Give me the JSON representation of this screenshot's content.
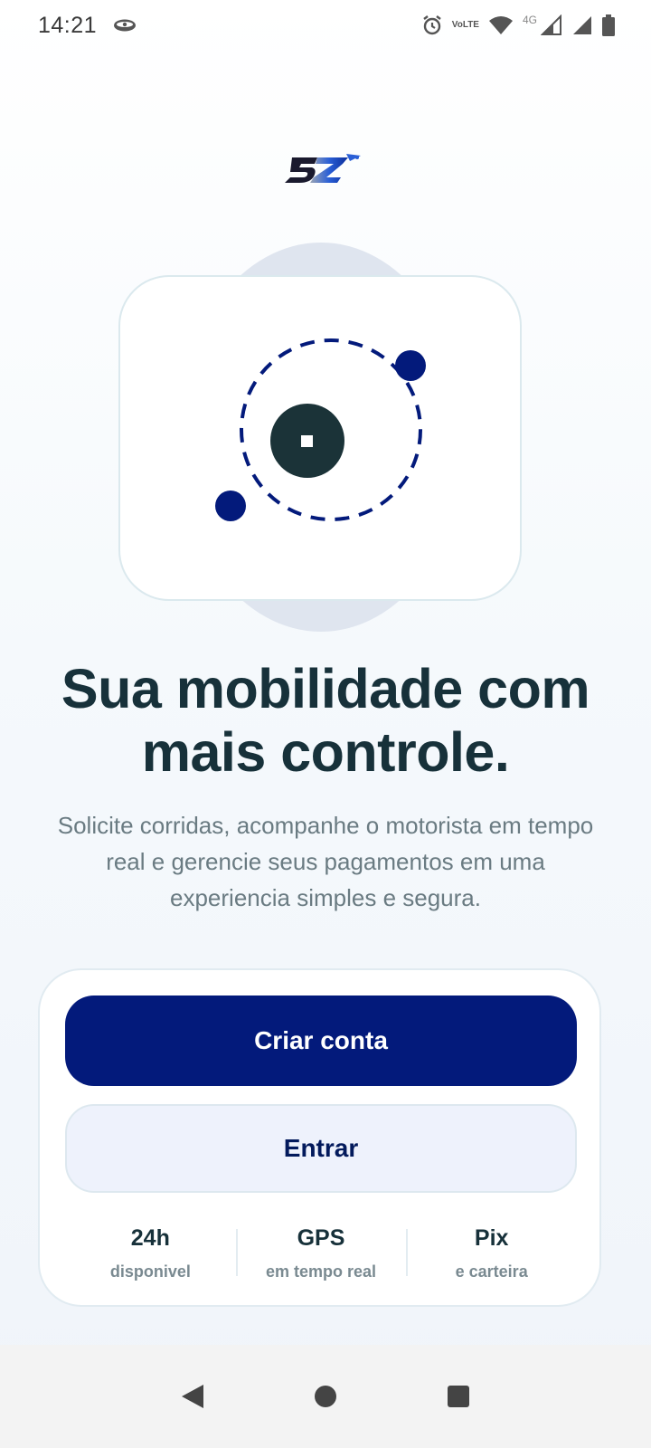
{
  "status_bar": {
    "time": "14:21",
    "volte_top": "Vo",
    "volte_bottom": "LTE",
    "network": "4G",
    "icons": [
      "eye-icon",
      "alarm-icon",
      "volte-icon",
      "wifi-icon",
      "signal-icon",
      "signal-icon",
      "battery-icon"
    ]
  },
  "logo": {
    "text": "5Z",
    "color": "#1e50c8"
  },
  "illustration": {
    "accent": "#031a7b",
    "center_color": "#1b3338",
    "back_color": "#dfe5ef"
  },
  "hero": {
    "title_line1": "Sua mobilidade com",
    "title_line2": "mais controle.",
    "subtitle": "Solicite corridas, acompanhe o motorista em tempo real e gerencie seus pagamentos em uma experiencia simples e segura."
  },
  "actions": {
    "create_account": "Criar conta",
    "login": "Entrar"
  },
  "stats": [
    {
      "value": "24h",
      "label": "disponivel"
    },
    {
      "value": "GPS",
      "label": "em tempo real"
    },
    {
      "value": "Pix",
      "label": "e carteira"
    }
  ],
  "colors": {
    "primary": "#031a7b",
    "text_dark": "#17313a",
    "text_muted": "#6a7b82",
    "secondary_bg": "#eef2fc"
  },
  "nav": [
    "back-icon",
    "home-icon",
    "recents-icon"
  ]
}
